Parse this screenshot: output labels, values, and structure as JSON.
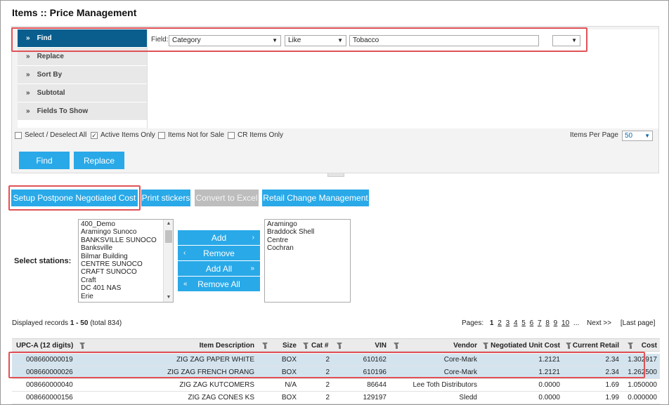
{
  "page": {
    "title": "Items :: Price Management"
  },
  "nav": {
    "items": [
      {
        "label": "Find",
        "active": true
      },
      {
        "label": "Replace",
        "active": false
      },
      {
        "label": "Sort By",
        "active": false
      },
      {
        "label": "Subtotal",
        "active": false
      },
      {
        "label": "Fields To Show",
        "active": false
      }
    ],
    "chevron": "»"
  },
  "find": {
    "field_label": "Field:",
    "field_value": "Category",
    "operator_value": "Like",
    "search_value": "Tobacco",
    "extra_value": ""
  },
  "options": {
    "select_all": {
      "label": "Select / Deselect All",
      "checked": false
    },
    "active_only": {
      "label": "Active Items Only",
      "checked": true
    },
    "not_for_sale": {
      "label": "Items Not for Sale",
      "checked": false
    },
    "cr_only": {
      "label": "CR Items Only",
      "checked": false
    },
    "items_per_page_label": "Items Per Page",
    "items_per_page_value": "50"
  },
  "buttons": {
    "find": "Find",
    "replace": "Replace"
  },
  "actions": {
    "postpone": "Setup Postpone Negotiated Cost",
    "print": "Print stickers",
    "excel": "Convert to Excel",
    "retail": "Retail Change Management"
  },
  "stations": {
    "label": "Select stations:",
    "available": [
      "400_Demo",
      "Aramingo Sunoco",
      "BANKSVILLE SUNOCO",
      "Banksville",
      "Bilmar Building",
      "CENTRE SUNOCO",
      "CRAFT SUNOCO",
      "Craft",
      "DC 401 NAS",
      "Erie"
    ],
    "selected": [
      "Aramingo",
      "Braddock Shell",
      "Centre",
      "Cochran"
    ],
    "add": "Add",
    "remove": "Remove",
    "add_all": "Add All",
    "remove_all": "Remove All"
  },
  "records": {
    "prefix": "Displayed records",
    "range": "1 - 50",
    "total": "(total 834)"
  },
  "pager": {
    "label": "Pages:",
    "current": "1",
    "pages": [
      "2",
      "3",
      "4",
      "5",
      "6",
      "7",
      "8",
      "9",
      "10"
    ],
    "ellipsis": "...",
    "next": "Next >>",
    "last": "[Last page]"
  },
  "table": {
    "headers": {
      "upc": "UPC-A (12 digits)",
      "desc": "Item Description",
      "size": "Size",
      "cat": "Cat #",
      "vin": "VIN",
      "vendor": "Vendor",
      "nuc": "Negotiated Unit Cost",
      "cr": "Current Retail",
      "cost": "Cost"
    },
    "rows": [
      {
        "upc": "008660000019",
        "desc": "ZIG ZAG PAPER WHITE",
        "size": "BOX",
        "cat": "2",
        "vin": "610162",
        "vendor": "Core-Mark",
        "nuc": "1.2121",
        "cr": "2.34",
        "cost": "1.302917",
        "selected": true
      },
      {
        "upc": "008660000026",
        "desc": "ZIG ZAG FRENCH ORANG",
        "size": "BOX",
        "cat": "2",
        "vin": "610196",
        "vendor": "Core-Mark",
        "nuc": "1.2121",
        "cr": "2.34",
        "cost": "1.262500",
        "selected": true
      },
      {
        "upc": "008660000040",
        "desc": "ZIG ZAG KUTCOMERS",
        "size": "N/A",
        "cat": "2",
        "vin": "86644",
        "vendor": "Lee Toth Distributors",
        "nuc": "0.0000",
        "cr": "1.69",
        "cost": "1.050000",
        "selected": false
      },
      {
        "upc": "008660000156",
        "desc": "ZIG ZAG CONES KS",
        "size": "BOX",
        "cat": "2",
        "vin": "129197",
        "vendor": "Sledd",
        "nuc": "0.0000",
        "cr": "1.99",
        "cost": "0.000000",
        "selected": false
      }
    ]
  },
  "colors": {
    "accent": "#29a9e8",
    "nav_active": "#095e8e",
    "highlight": "#e05257",
    "row_selected": "#d4e4ef"
  }
}
